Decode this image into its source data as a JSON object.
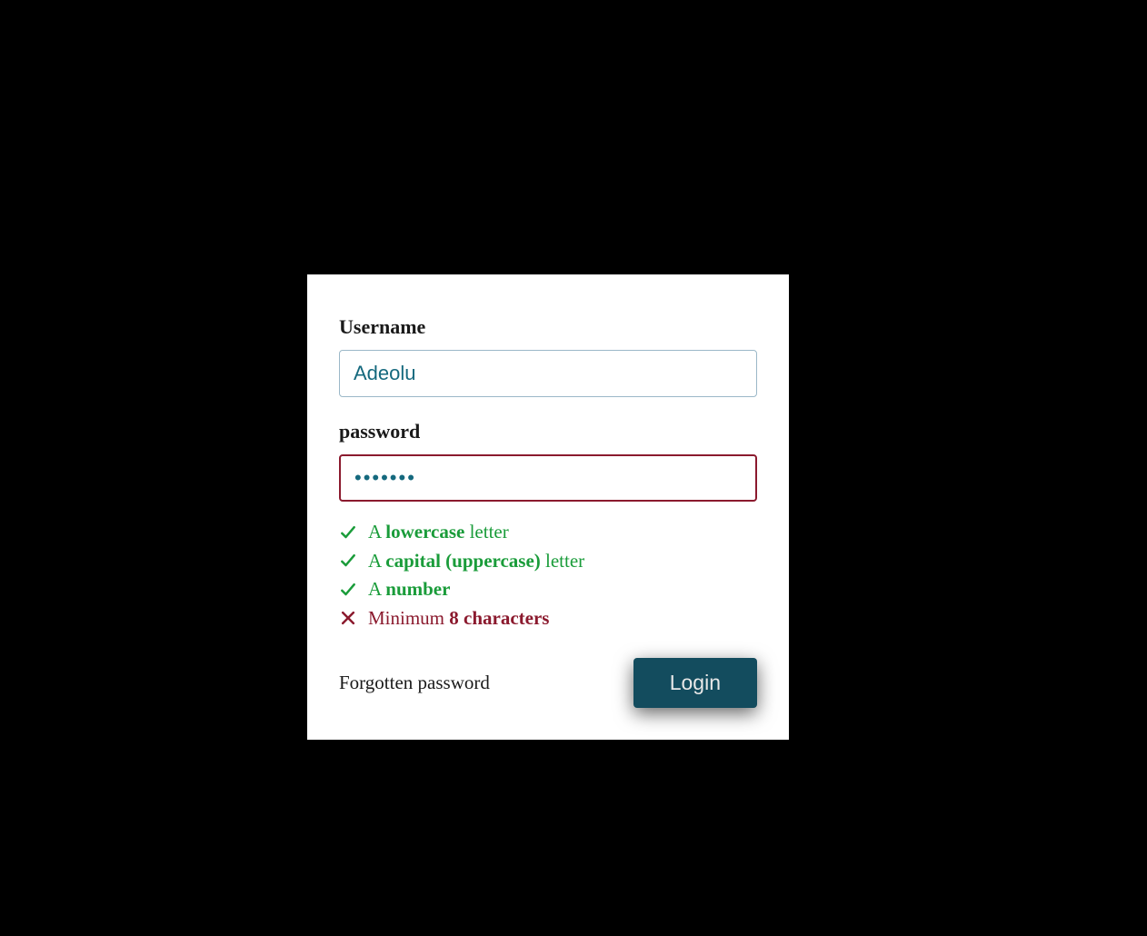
{
  "form": {
    "username": {
      "label": "Username",
      "value": "Adeolu"
    },
    "password": {
      "label": "password",
      "value": "•••••••"
    },
    "validation": [
      {
        "status": "valid",
        "prefix": "A ",
        "bold": "lowercase",
        "suffix": " letter"
      },
      {
        "status": "valid",
        "prefix": "A ",
        "bold": "capital (uppercase)",
        "suffix": " letter"
      },
      {
        "status": "valid",
        "prefix": "A ",
        "bold": "number",
        "suffix": ""
      },
      {
        "status": "invalid",
        "prefix": "Minimum ",
        "bold": "8 characters",
        "suffix": ""
      }
    ],
    "forgotten_label": "Forgotten password",
    "login_label": "Login"
  },
  "colors": {
    "valid": "#1a9c3a",
    "invalid": "#8b1a2e",
    "accent": "#134c5e"
  }
}
